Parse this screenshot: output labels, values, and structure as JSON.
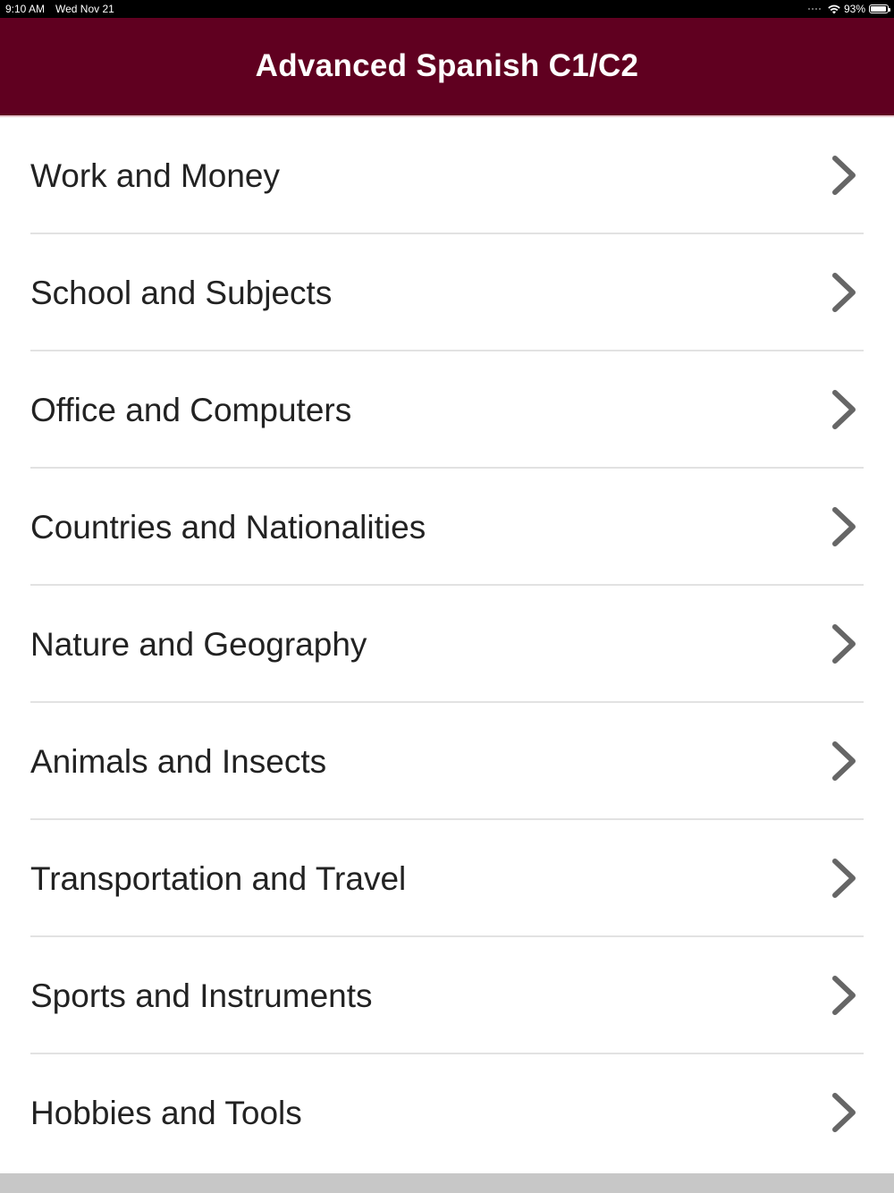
{
  "status_bar": {
    "time": "9:10 AM",
    "date": "Wed Nov 21",
    "battery": "93%",
    "battery_level": 0.93,
    "icons": [
      "signal-dots-icon",
      "wifi-icon",
      "battery-icon"
    ]
  },
  "nav": {
    "title": "Advanced Spanish C1/C2"
  },
  "colors": {
    "nav_background": "#600020",
    "text": "#222222",
    "chevron": "#666666",
    "divider": "#e2e2e2"
  },
  "categories": [
    {
      "label": "Work and Money",
      "icon": "chevron-right-icon"
    },
    {
      "label": "School and Subjects",
      "icon": "chevron-right-icon"
    },
    {
      "label": "Office and Computers",
      "icon": "chevron-right-icon"
    },
    {
      "label": "Countries and Nationalities",
      "icon": "chevron-right-icon"
    },
    {
      "label": "Nature and Geography",
      "icon": "chevron-right-icon"
    },
    {
      "label": "Animals and Insects",
      "icon": "chevron-right-icon"
    },
    {
      "label": "Transportation and Travel",
      "icon": "chevron-right-icon"
    },
    {
      "label": "Sports and Instruments",
      "icon": "chevron-right-icon"
    },
    {
      "label": "Hobbies and Tools",
      "icon": "chevron-right-icon"
    }
  ]
}
